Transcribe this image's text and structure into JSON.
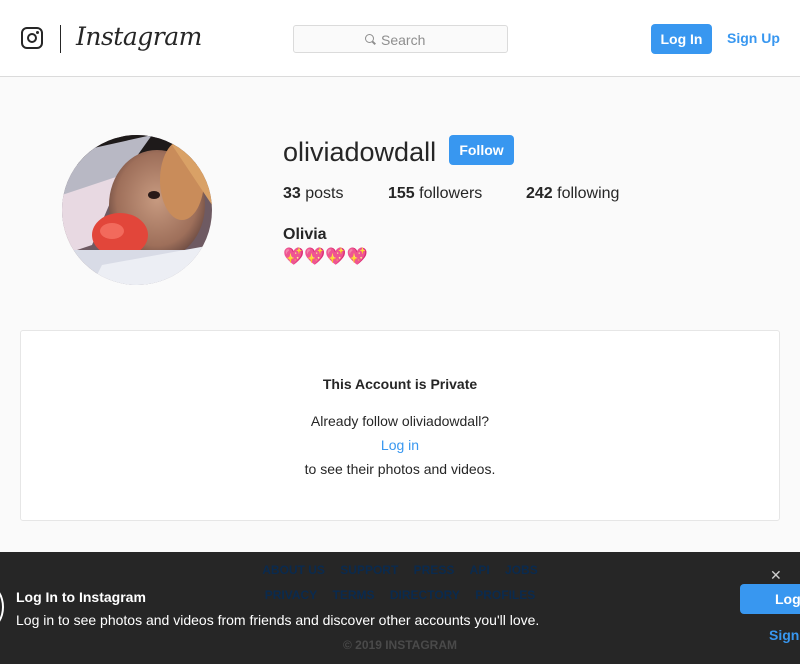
{
  "header": {
    "logo_text": "Instagram",
    "search_placeholder": "Search",
    "login_label": "Log In",
    "signup_label": "Sign Up"
  },
  "profile": {
    "username": "oliviadowdall",
    "follow_label": "Follow",
    "posts_count": "33",
    "posts_label": "posts",
    "followers_count": "155",
    "followers_label": "followers",
    "following_count": "242",
    "following_label": "following",
    "full_name": "Olivia",
    "bio": "💖💖💖💖"
  },
  "private_card": {
    "title": "This Account is Private",
    "already_follow": "Already follow oliviadowdall?",
    "login_link": "Log in",
    "see_text": "to see their photos and videos."
  },
  "footer": {
    "links_row1": [
      "ABOUT US",
      "SUPPORT",
      "PRESS",
      "API",
      "JOBS"
    ],
    "links_row2": [
      "PRIVACY",
      "TERMS",
      "DIRECTORY",
      "PROFILES"
    ],
    "copyright": "© 2019 INSTAGRAM"
  },
  "login_banner": {
    "title": "Log In to Instagram",
    "text": "Log in to see photos and videos from friends and discover other accounts you'll love.",
    "close_label": "✕",
    "login_label": "Log",
    "signup_label": "Sign"
  },
  "colors": {
    "accent": "#3897f0",
    "footer_bg": "#262626"
  }
}
